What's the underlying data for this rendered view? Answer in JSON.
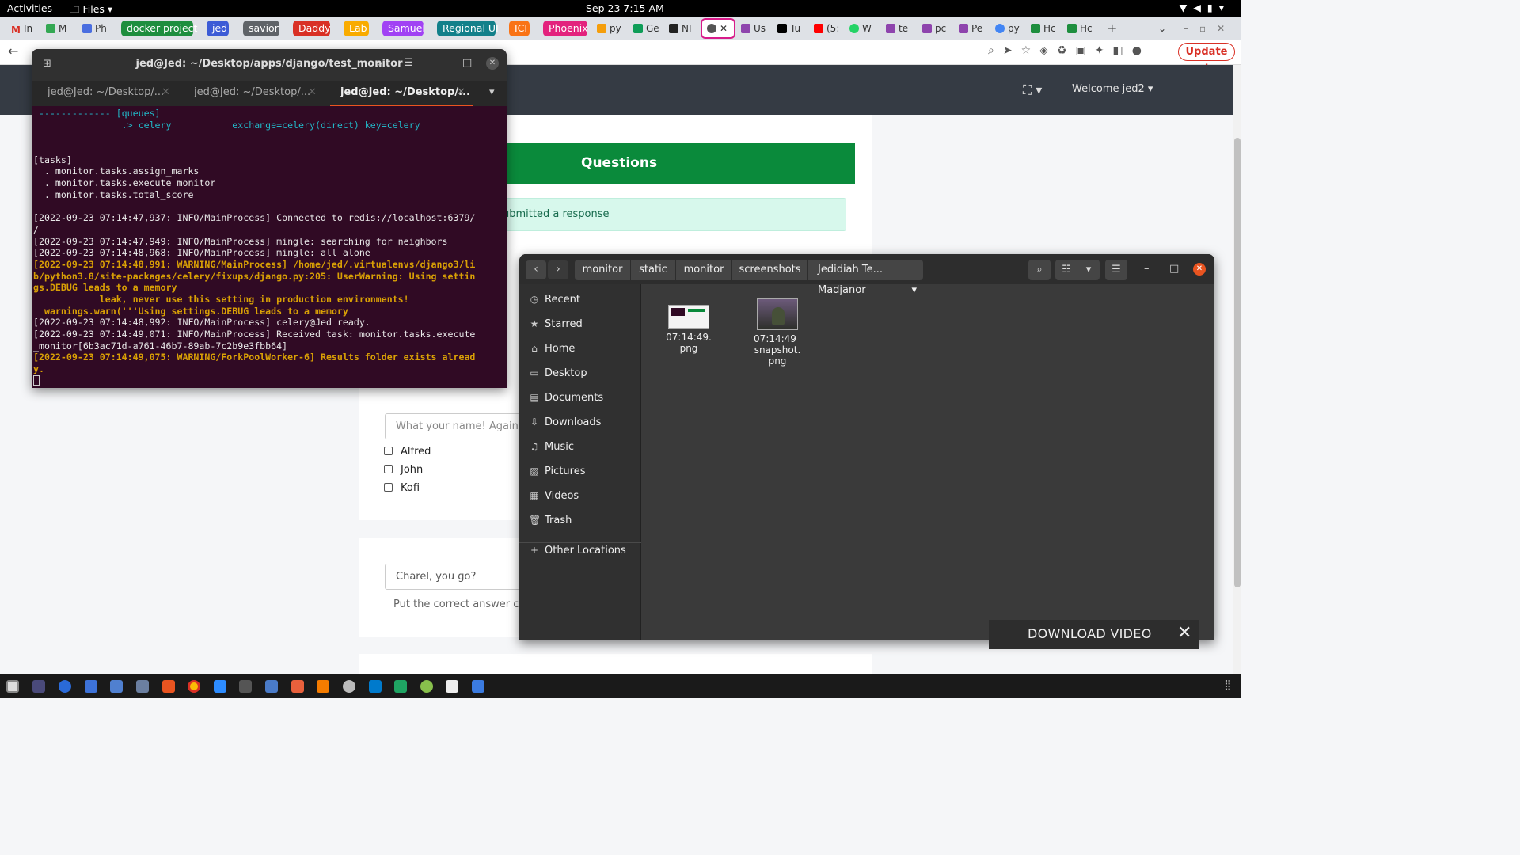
{
  "topbar": {
    "activities": "Activities",
    "app_menu": "Files",
    "clock": "Sep 23  7:15 AM"
  },
  "browser": {
    "tabs": [
      {
        "label": "In",
        "color": "#d93025"
      },
      {
        "label": "M",
        "color": "#34a853"
      },
      {
        "label": "Ph",
        "color": "#4a6ee0"
      }
    ],
    "tab_groups": [
      {
        "label": "docker project",
        "color": "#1e8e3e"
      },
      {
        "label": "jed",
        "color": "#3c5bd6"
      },
      {
        "label": "savior",
        "color": "#5f6368"
      },
      {
        "label": "Daddy",
        "color": "#d93025"
      },
      {
        "label": "Lab",
        "color": "#f9ab00"
      },
      {
        "label": "Samuel",
        "color": "#a142f4"
      },
      {
        "label": "Regional UI",
        "color": "#12808a"
      },
      {
        "label": "ICI",
        "color": "#f97316"
      },
      {
        "label": "Phoenix",
        "color": "#e3227d"
      }
    ],
    "tabs_right": [
      {
        "label": "py",
        "color": "#f59e0b"
      },
      {
        "label": "Ge",
        "color": "#0f9d58"
      },
      {
        "label": "NI",
        "color": "#222222"
      },
      {
        "label": "Us",
        "color": "#8e44ad"
      },
      {
        "label": "Tu",
        "color": "#000000"
      },
      {
        "label": "(5:",
        "color": "#ff0000"
      },
      {
        "label": "W",
        "color": "#25d366"
      },
      {
        "label": "te",
        "color": "#8e44ad"
      },
      {
        "label": "pc",
        "color": "#8e44ad"
      },
      {
        "label": "Pe",
        "color": "#8e44ad"
      },
      {
        "label": "py",
        "color": "#4285f4"
      },
      {
        "label": "Hc",
        "color": "#1e8e3e"
      },
      {
        "label": "Hc",
        "color": "#1e8e3e"
      }
    ],
    "new_tab": "+",
    "update_button": "Update"
  },
  "webpage": {
    "welcome": "Welcome jed2",
    "questions_title": "Questions",
    "alert_text": "ubmitted a response",
    "q1_placeholder": "What your name! Again?",
    "q1_options": [
      "Alfred",
      "John",
      "Kofi"
    ],
    "q2_placeholder": "Charel, you go?",
    "q2_hint": "Put the correct answer choic"
  },
  "terminal": {
    "title": "jed@Jed: ~/Desktop/apps/django/test_monitor",
    "tabs": [
      "jed@Jed: ~/Desktop/...",
      "jed@Jed: ~/Desktop/...",
      "jed@Jed: ~/Desktop/..."
    ],
    "lines": [
      {
        "text": " ------------- [queues]",
        "style": "cyan"
      },
      {
        "text": "                .> celery           exchange=celery(direct) key=celery",
        "style": "cyan"
      },
      {
        "text": "",
        "style": "normal"
      },
      {
        "text": "",
        "style": "normal"
      },
      {
        "text": "[tasks]",
        "style": "normal"
      },
      {
        "text": "  . monitor.tasks.assign_marks",
        "style": "normal"
      },
      {
        "text": "  . monitor.tasks.execute_monitor",
        "style": "normal"
      },
      {
        "text": "  . monitor.tasks.total_score",
        "style": "normal"
      },
      {
        "text": "",
        "style": "normal"
      },
      {
        "text": "[2022-09-23 07:14:47,937: INFO/MainProcess] Connected to redis://localhost:6379/",
        "style": "normal"
      },
      {
        "text": "/",
        "style": "normal"
      },
      {
        "text": "[2022-09-23 07:14:47,949: INFO/MainProcess] mingle: searching for neighbors",
        "style": "normal"
      },
      {
        "text": "[2022-09-23 07:14:48,968: INFO/MainProcess] mingle: all alone",
        "style": "normal"
      },
      {
        "text": "[2022-09-23 07:14:48,991: WARNING/MainProcess] /home/jed/.virtualenvs/django3/li",
        "style": "warn"
      },
      {
        "text": "b/python3.8/site-packages/celery/fixups/django.py:205: UserWarning: Using settin",
        "style": "warn"
      },
      {
        "text": "gs.DEBUG leads to a memory",
        "style": "warn"
      },
      {
        "text": "            leak, never use this setting in production environments!",
        "style": "warn"
      },
      {
        "text": "  warnings.warn('''Using settings.DEBUG leads to a memory",
        "style": "warn"
      },
      {
        "text": "[2022-09-23 07:14:48,992: INFO/MainProcess] celery@Jed ready.",
        "style": "normal"
      },
      {
        "text": "[2022-09-23 07:14:49,071: INFO/MainProcess] Received task: monitor.tasks.execute",
        "style": "normal"
      },
      {
        "text": "_monitor[6b3ac71d-a761-46b7-89ab-7c2b9e3fbb64]",
        "style": "normal"
      },
      {
        "text": "[2022-09-23 07:14:49,075: WARNING/ForkPoolWorker-6] Results folder exists alread",
        "style": "warn"
      },
      {
        "text": "y.",
        "style": "warn"
      }
    ]
  },
  "files": {
    "breadcrumbs": [
      "monitor",
      "static",
      "monitor",
      "screenshots",
      "Jedidiah Te... Madjanor"
    ],
    "sidebar": [
      "Recent",
      "Starred",
      "Home",
      "Desktop",
      "Documents",
      "Downloads",
      "Music",
      "Pictures",
      "Videos",
      "Trash"
    ],
    "other_locations": "Other Locations",
    "items": [
      {
        "name_line1": "07:14:49.",
        "name_line2": "png",
        "name_line3": ""
      },
      {
        "name_line1": "07:14:49_",
        "name_line2": "snapshot.",
        "name_line3": "png"
      }
    ]
  },
  "download_bar": {
    "label": "DOWNLOAD VIDEO"
  }
}
